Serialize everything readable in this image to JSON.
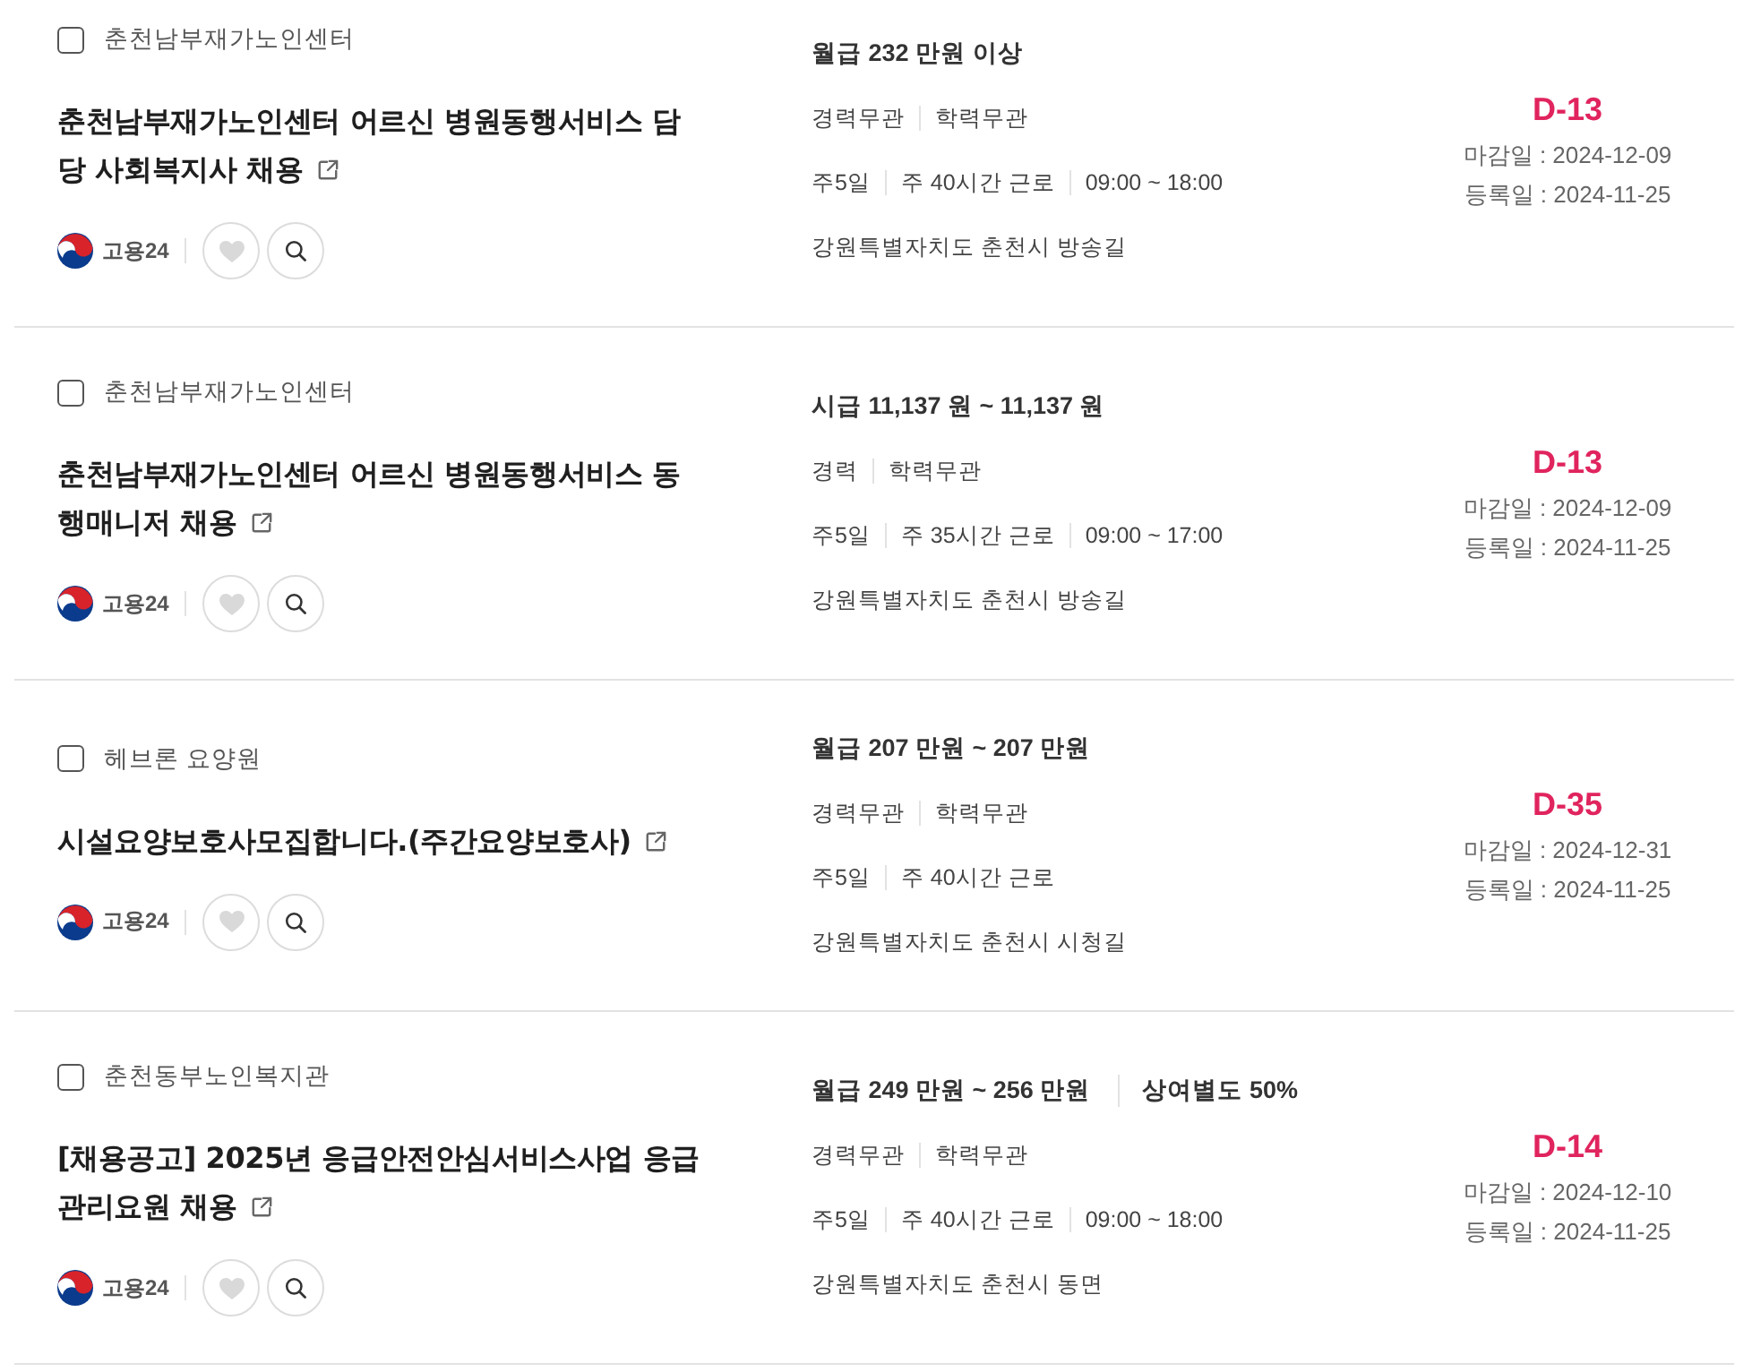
{
  "listings": [
    {
      "company": "춘천남부재가노인센터",
      "checked": false,
      "title": "춘천남부재가노인센터 어르신 병원동행서비스 담당 사회복지사 채용",
      "source": "고용24",
      "liked": false,
      "salary": [
        "월급 232 만원 이상"
      ],
      "conditions": [
        "경력무관",
        "학력무관"
      ],
      "schedule": [
        "주5일",
        "주 40시간 근로",
        "09:00 ~ 18:00"
      ],
      "location": "강원특별자치도 춘천시 방송길",
      "dday": "D-13",
      "deadline": "마감일 : 2024-12-09",
      "registered": "등록일 : 2024-11-25"
    },
    {
      "company": "춘천남부재가노인센터",
      "checked": false,
      "title": "춘천남부재가노인센터 어르신 병원동행서비스 동행매니저 채용",
      "source": "고용24",
      "liked": false,
      "salary": [
        "시급 11,137 원 ~ 11,137 원"
      ],
      "conditions": [
        "경력",
        "학력무관"
      ],
      "schedule": [
        "주5일",
        "주 35시간 근로",
        "09:00 ~ 17:00"
      ],
      "location": "강원특별자치도 춘천시 방송길",
      "dday": "D-13",
      "deadline": "마감일 : 2024-12-09",
      "registered": "등록일 : 2024-11-25"
    },
    {
      "company": "헤브론 요양원",
      "checked": false,
      "title": "시설요양보호사모집합니다.(주간요양보호사)",
      "source": "고용24",
      "liked": false,
      "salary": [
        "월급 207 만원 ~ 207 만원"
      ],
      "conditions": [
        "경력무관",
        "학력무관"
      ],
      "schedule": [
        "주5일",
        "주 40시간 근로"
      ],
      "location": "강원특별자치도 춘천시 시청길",
      "dday": "D-35",
      "deadline": "마감일 : 2024-12-31",
      "registered": "등록일 : 2024-11-25"
    },
    {
      "company": "춘천동부노인복지관",
      "checked": false,
      "title": "[채용공고] 2025년 응급안전안심서비스사업 응급관리요원 채용",
      "source": "고용24",
      "liked": false,
      "salary": [
        "월급 249 만원 ~ 256 만원",
        "상여별도 50%"
      ],
      "conditions": [
        "경력무관",
        "학력무관"
      ],
      "schedule": [
        "주5일",
        "주 40시간 근로",
        "09:00 ~ 18:00"
      ],
      "location": "강원특별자치도 춘천시 동면",
      "dday": "D-14",
      "deadline": "마감일 : 2024-12-10",
      "registered": "등록일 : 2024-11-25"
    }
  ]
}
